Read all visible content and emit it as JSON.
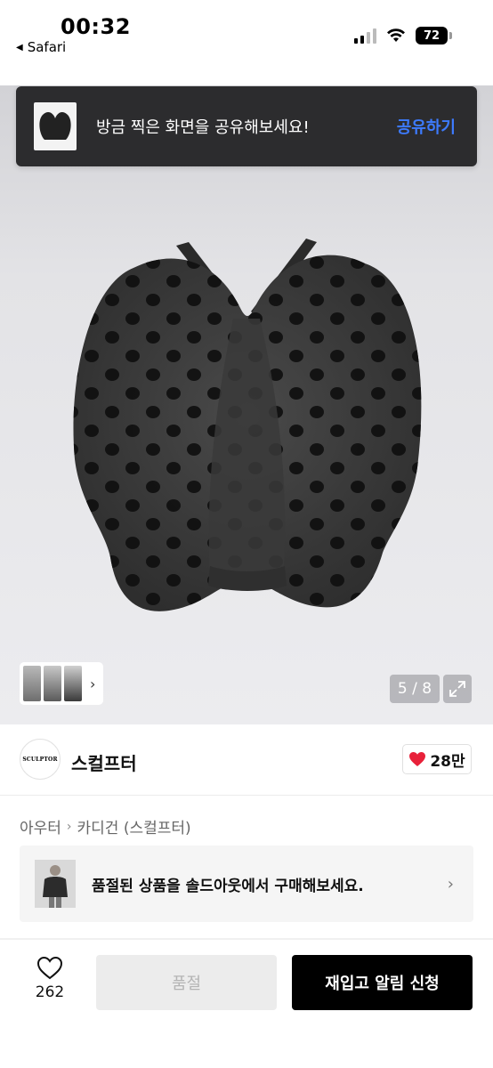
{
  "status_bar": {
    "time": "00:32",
    "back_app": "Safari",
    "battery": "72"
  },
  "toast": {
    "message": "방금 찍은 화면을 공유해보세요!",
    "action": "공유하기"
  },
  "gallery": {
    "counter": "5 / 8",
    "current": 5,
    "total": 8
  },
  "brand": {
    "logo_text": "SCULPTOR",
    "name": "스컬프터",
    "likes": "28만"
  },
  "breadcrumb": {
    "items": [
      "아우터",
      "카디건 (스컬프터)"
    ]
  },
  "soldout_banner": {
    "text": "품절된 상품을 솔드아웃에서 구매해보세요."
  },
  "bottom_bar": {
    "wish_count": "262",
    "soldout_label": "품절",
    "restock_label": "재입고 알림 신청"
  },
  "colors": {
    "accent_blue": "#3d7bff",
    "like_red": "#e8213a",
    "cta_black": "#000000"
  },
  "icons": [
    "signal-icon",
    "wifi-icon",
    "battery-icon",
    "chevron-right-icon",
    "expand-icon",
    "heart-filled-icon",
    "heart-outline-icon"
  ]
}
